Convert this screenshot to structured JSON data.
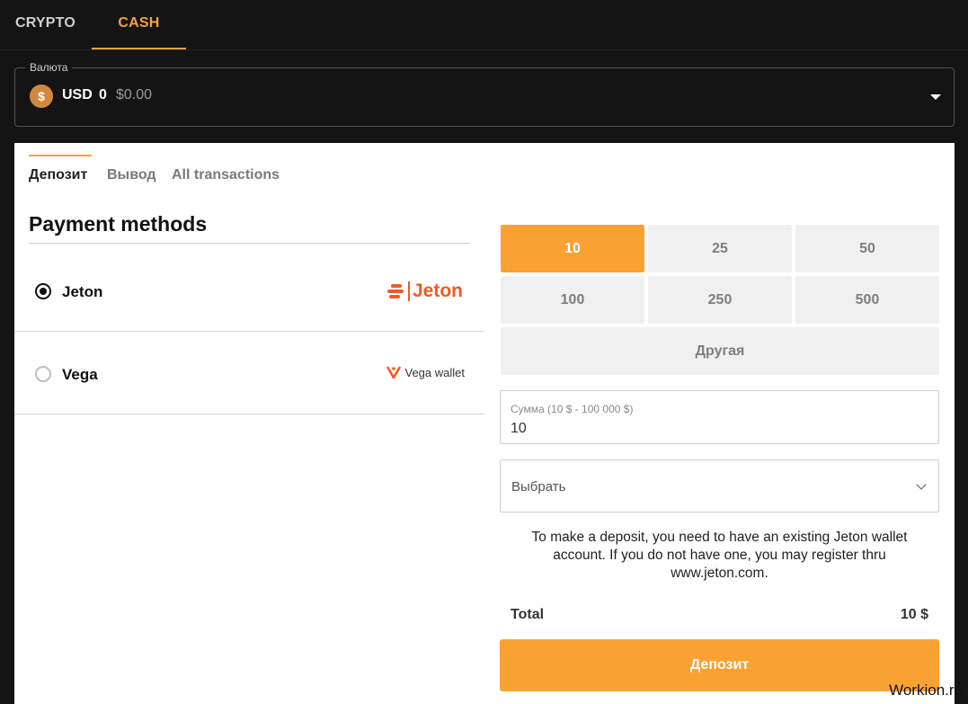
{
  "top_tabs": {
    "crypto": "CRYPTO",
    "cash": "CASH"
  },
  "currency": {
    "legend": "Валюта",
    "coin_symbol": "$",
    "code": "USD",
    "amount": "0",
    "usd_value": "$0.00"
  },
  "sub_tabs": {
    "deposit": "Депозит",
    "withdraw": "Вывод",
    "transactions": "All transactions"
  },
  "payment": {
    "title": "Payment methods",
    "methods": [
      {
        "name": "Jeton",
        "logo_text": "Jeton",
        "selected": true
      },
      {
        "name": "Vega",
        "logo_text": "Vega wallet",
        "selected": false
      }
    ]
  },
  "amounts": {
    "options": [
      "10",
      "25",
      "50",
      "100",
      "250",
      "500"
    ],
    "other": "Другая",
    "selected": "10"
  },
  "sum_field": {
    "label": "Сумма (10 $ - 100 000 $)",
    "value": "10"
  },
  "select": {
    "placeholder": "Выбрать"
  },
  "info_text": "To make a deposit, you need to have an existing Jeton wallet account. If you do not have one, you may register thru www.jeton.com.",
  "total": {
    "label": "Total",
    "value": "10 $"
  },
  "deposit_button": "Депозит",
  "watermark": "Workion.ru",
  "colors": {
    "accent": "#f9a233",
    "jeton_brand": "#f15a22",
    "background": "#141414"
  }
}
